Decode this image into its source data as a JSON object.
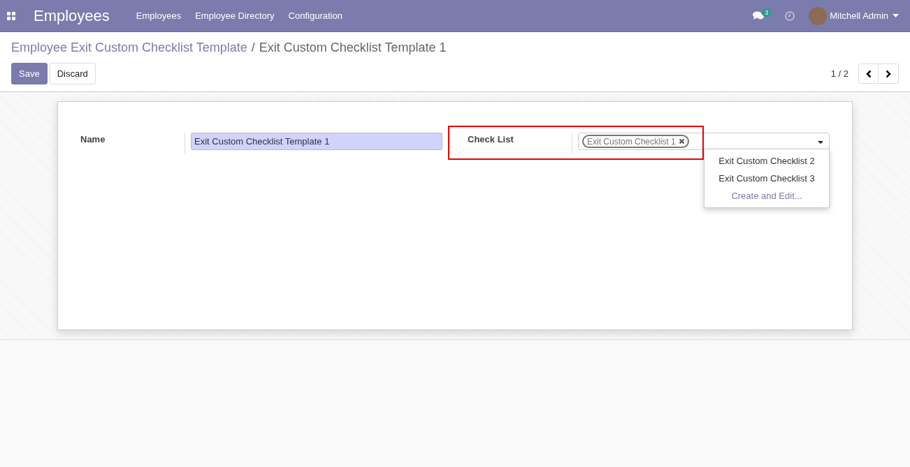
{
  "navbar": {
    "app_title": "Employees",
    "menu": [
      "Employees",
      "Employee Directory",
      "Configuration"
    ],
    "messages_badge": "3",
    "user": "Mitchell Admin"
  },
  "breadcrumb": [
    {
      "label": "Employee Exit Custom Checklist Template",
      "kind": "link"
    },
    {
      "label": "/",
      "kind": "separator"
    },
    {
      "label": "Exit Custom Checklist Template 1",
      "kind": "current"
    }
  ],
  "buttons": [
    {
      "label": "Save",
      "kind": "primary"
    },
    {
      "label": "Discard",
      "kind": "secondary"
    }
  ],
  "pager": {
    "text": "1 / 2"
  },
  "form": {
    "name": {
      "label": "Name",
      "value": "Exit Custom Checklist Template 1"
    },
    "check_list": {
      "label": "Check List",
      "tags": [
        "Exit Custom Checklist 1"
      ],
      "highlighted": true,
      "dropdown": [
        {
          "label": "Exit Custom Checklist 2",
          "kind": "option"
        },
        {
          "label": "Exit Custom Checklist 3",
          "kind": "option"
        },
        {
          "label": "Create and Edit...",
          "kind": "action"
        }
      ]
    }
  }
}
